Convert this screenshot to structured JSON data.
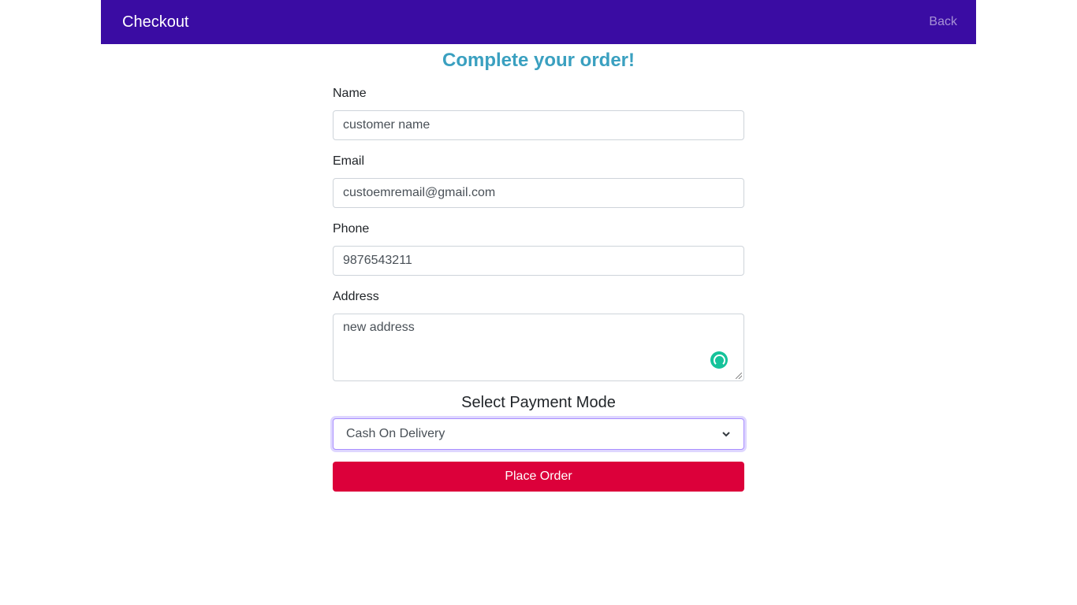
{
  "navbar": {
    "brand": "Checkout",
    "back_label": "Back"
  },
  "heading": "Complete your order!",
  "form": {
    "name_label": "Name",
    "name_value": "customer name",
    "email_label": "Email",
    "email_value": "custoemremail@gmail.com",
    "phone_label": "Phone",
    "phone_value": "9876543211",
    "address_label": "Address",
    "address_value": "new address",
    "payment_title": "Select Payment Mode",
    "payment_selected": "Cash On Delivery",
    "submit_label": "Place Order"
  },
  "colors": {
    "navbar": "#3a0ca3",
    "heading": "#3aa0c0",
    "submit": "#dc003a",
    "grammar_icon": "#15c39a"
  },
  "icons": [
    "chevron-down-icon",
    "grammar-assistant-icon",
    "resize-grip-icon"
  ]
}
